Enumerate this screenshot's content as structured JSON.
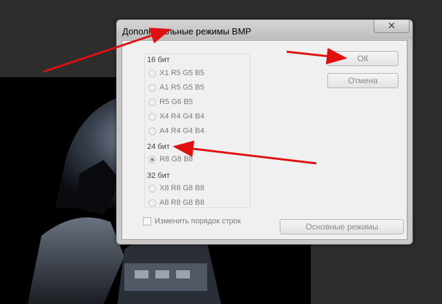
{
  "dialog": {
    "title": "Дополнительные режимы BMP",
    "close_glyph": "✕"
  },
  "group_16": {
    "label": "16 бит",
    "options": [
      "X1 R5 G5 B5",
      "A1 R5 G5 B5",
      "R5 G6 B5",
      "X4 R4 G4 B4",
      "A4 R4 G4 B4"
    ]
  },
  "group_24": {
    "label": "24 бит",
    "options": [
      "R8 G8 B8"
    ],
    "selected": "R8 G8 B8"
  },
  "group_32": {
    "label": "32 бит",
    "options": [
      "X8 R8 G8 B8",
      "A8 R8 G8 B8"
    ]
  },
  "buttons": {
    "ok": "ОК",
    "cancel": "Отмена",
    "basic_modes": "Основные режимы"
  },
  "checkbox": {
    "label": "Изменить порядок строк",
    "checked": false
  },
  "colors": {
    "arrow": "#e01010",
    "window_frame": "#c9c9c9",
    "client_bg": "#f0f0f0"
  }
}
